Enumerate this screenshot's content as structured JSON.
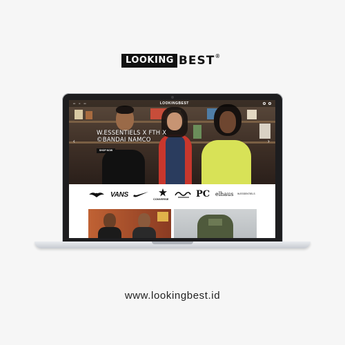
{
  "brand": {
    "logo_box_text": "LOOKING",
    "logo_rest_text": "EST",
    "logo_b_glyph": "B",
    "registered": "®"
  },
  "site": {
    "nav_logo": "LOOKINGBEST",
    "hero_title": "W.ESSENTIELS X FTH X ©BANDAI NAMCO",
    "shop_button": "SHOP NOW",
    "arrow_prev": "‹",
    "arrow_next": "›",
    "brands": [
      "VANS",
      "CONVERSE",
      "PC",
      "elhaus",
      "W.ESSENTIELS"
    ]
  },
  "footer": {
    "url": "www.lookingbest.id"
  },
  "colors": {
    "accent_red": "#c8372d",
    "accent_yellow": "#d8e257",
    "dark": "#111111"
  }
}
